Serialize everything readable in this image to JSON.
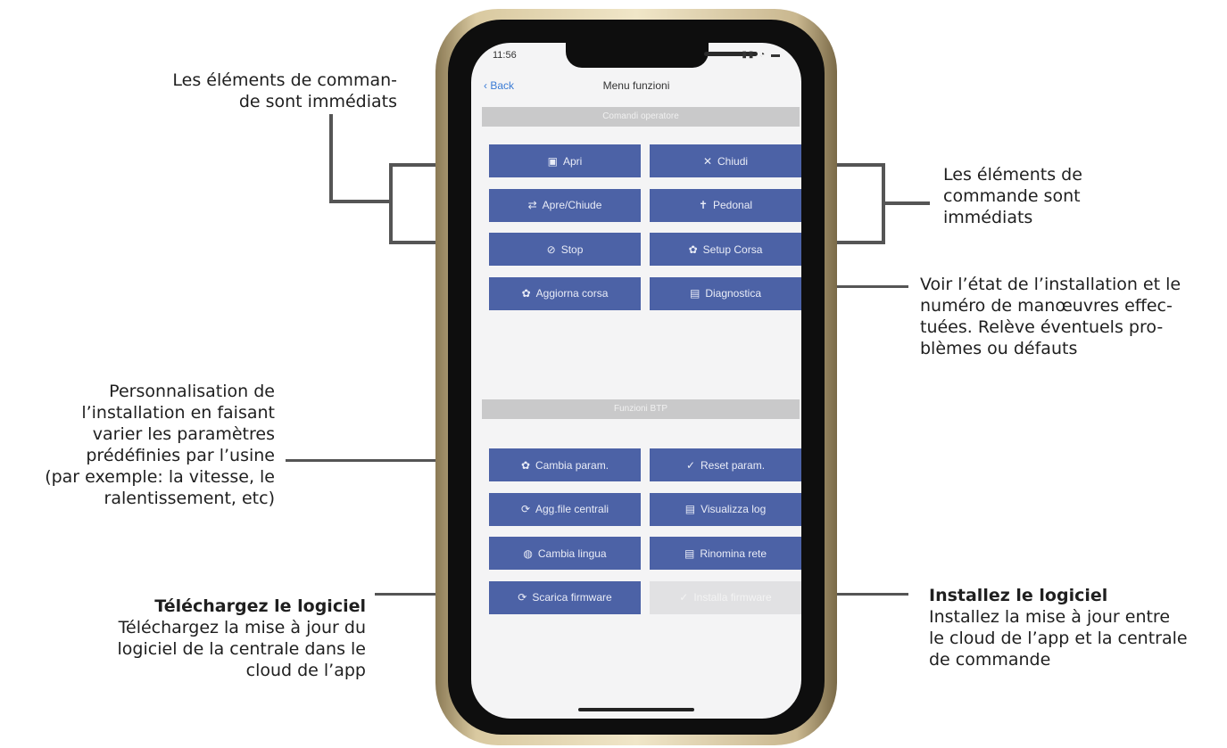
{
  "annotations": {
    "top_left": "Les éléments de comman-\nde sont immédiats",
    "top_right": "Les éléments de\ncommande sont\nimmédiats",
    "diagnostic": "Voir l’état de l’installation et le\nnuméro de manœuvres effec-\ntuées. Relève éventuels pro-\nblèmes ou défauts",
    "params": "Personnalisation de\nl’installation en faisant\nvarier les paramètres\nprédéfinies par l’usine\n(par exemple: la vitesse, le\nralentissement, etc)",
    "download_title": "Téléchargez le logiciel",
    "download_text": "Téléchargez la mise à jour du\nlogiciel de la centrale dans le\ncloud de l’app",
    "install_title": "Installez le logiciel",
    "install_text": "Installez la mise à jour entre\nle cloud de l’app et la centrale\nde commande"
  },
  "phone": {
    "status_time": "11:56",
    "status_icons": "▮▮ ◔ ▬",
    "back_label": "Back",
    "title": "Menu funzioni",
    "section1": "Comandi operatore",
    "section2": "Funzioni BTP",
    "buttons": [
      {
        "label": "Apri",
        "icon": "▣"
      },
      {
        "label": "Chiudi",
        "icon": "✕"
      },
      {
        "label": "Apre/Chiude",
        "icon": "⇄"
      },
      {
        "label": "Pedonal",
        "icon": "✝"
      },
      {
        "label": "Stop",
        "icon": "⊘"
      },
      {
        "label": "Setup Corsa",
        "icon": "✿"
      },
      {
        "label": "Aggiorna corsa",
        "icon": "✿"
      },
      {
        "label": "Diagnostica",
        "icon": "▤"
      },
      {
        "label": "Cambia param.",
        "icon": "✿"
      },
      {
        "label": "Reset param.",
        "icon": "✓"
      },
      {
        "label": "Agg.file centrali",
        "icon": "⟳"
      },
      {
        "label": "Visualizza log",
        "icon": "▤"
      },
      {
        "label": "Cambia lingua",
        "icon": "◍"
      },
      {
        "label": "Rinomina rete",
        "icon": "▤"
      },
      {
        "label": "Scarica firmware",
        "icon": "⟳"
      },
      {
        "label": "Installa firmware",
        "icon": "✓"
      }
    ]
  },
  "colors": {
    "button": "#4c62a6",
    "button_disabled": "#e1e1e3",
    "section": "#c9c9ca",
    "accent": "#3a7bd5"
  }
}
